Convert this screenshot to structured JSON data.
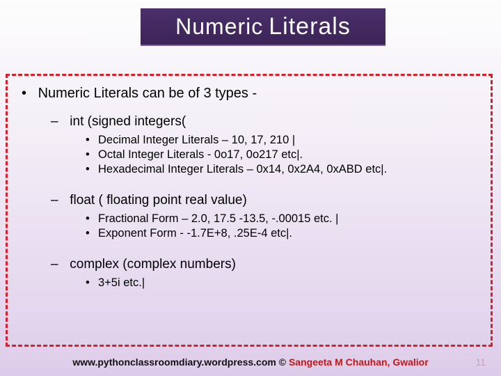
{
  "title": {
    "w1": "Numeric",
    "w2": "Literals"
  },
  "intro": "Numeric Literals  can be of 3 types -",
  "types": {
    "int": {
      "label": "int (signed integers(",
      "items": [
        "Decimal Integer Literals – 10, 17, 210 |",
        "Octal Integer Literals  - 0o17, 0o217 etc|.",
        "Hexadecimal Integer Literals – 0x14, 0x2A4, 0xABD etc|."
      ]
    },
    "float": {
      "label": "float ( floating point real value)",
      "items": [
        "Fractional Form – 2.0, 17.5 -13.5, -.00015 etc. |",
        "Exponent Form - -1.7E+8, .25E-4 etc|."
      ]
    },
    "complex": {
      "label": "complex (complex numbers)",
      "items": [
        "3+5i etc.|"
      ]
    }
  },
  "footer": {
    "url": "www.pythonclassroomdiary.wordpress.com",
    "sep": " © ",
    "author": "Sangeeta M Chauhan, Gwalior"
  },
  "page": "11"
}
